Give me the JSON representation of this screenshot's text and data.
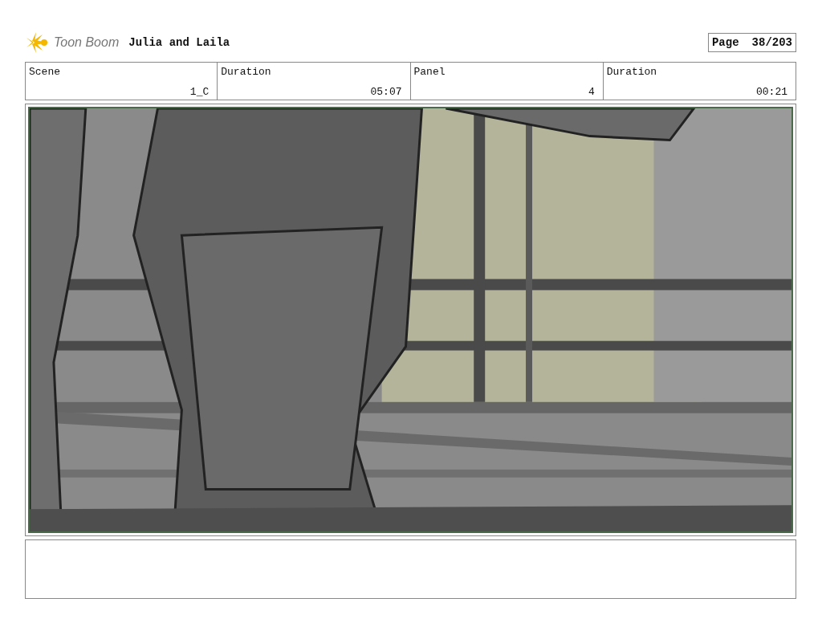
{
  "header": {
    "logo_text": "Toon Boom",
    "project_title": "Julia and Laila",
    "page_label": "Page",
    "page_number": "38/203"
  },
  "fields": [
    {
      "label": "Scene",
      "value": "1_C"
    },
    {
      "label": "Duration",
      "value": "05:07"
    },
    {
      "label": "Panel",
      "value": "4"
    },
    {
      "label": "Duration",
      "value": "00:21"
    }
  ]
}
